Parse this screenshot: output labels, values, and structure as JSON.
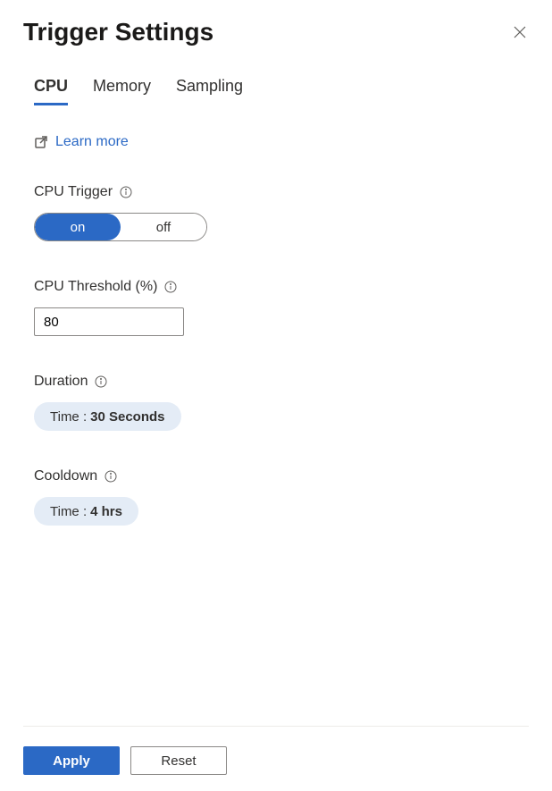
{
  "header": {
    "title": "Trigger Settings"
  },
  "tabs": [
    {
      "label": "CPU",
      "active": true
    },
    {
      "label": "Memory",
      "active": false
    },
    {
      "label": "Sampling",
      "active": false
    }
  ],
  "learnMore": {
    "label": "Learn more"
  },
  "cpuTrigger": {
    "label": "CPU Trigger",
    "onLabel": "on",
    "offLabel": "off",
    "value": "on"
  },
  "cpuThreshold": {
    "label": "CPU Threshold (%)",
    "value": "80"
  },
  "duration": {
    "label": "Duration",
    "timeLabel": "Time : ",
    "value": "30 Seconds"
  },
  "cooldown": {
    "label": "Cooldown",
    "timeLabel": "Time : ",
    "value": "4 hrs"
  },
  "footer": {
    "apply": "Apply",
    "reset": "Reset"
  }
}
